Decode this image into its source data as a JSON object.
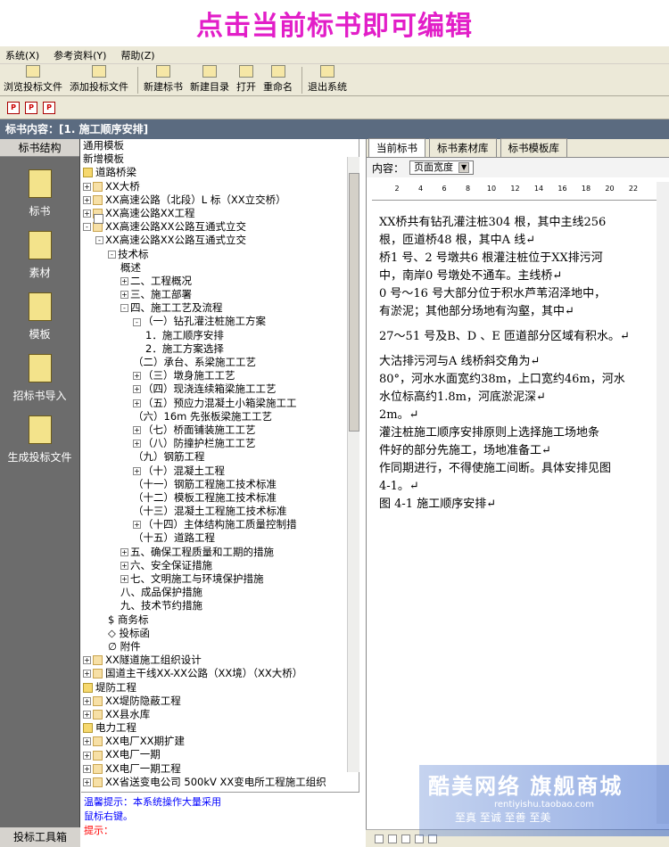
{
  "banner": "点击当前标书即可编辑",
  "menu": [
    "系统(X)",
    "参考资料(Y)",
    "帮助(Z)"
  ],
  "toolbar": [
    "浏览投标文件",
    "添加投标文件",
    "新建标书",
    "新建目录",
    "打开",
    "重命名",
    "退出系统"
  ],
  "title": "标书内容：[1. 施工顺序安排]",
  "left": {
    "header": "标书结构",
    "buttons": [
      "标书",
      "素材",
      "模板",
      "招标书导入",
      "生成投标文件"
    ],
    "footer": "投标工具箱"
  },
  "tree": [
    {
      "indent": 0,
      "box": "",
      "icon": "",
      "label": "通用模板"
    },
    {
      "indent": 0,
      "box": "",
      "icon": "",
      "label": "新增模板"
    },
    {
      "indent": 0,
      "box": "",
      "icon": "folder",
      "label": "道路桥梁"
    },
    {
      "indent": 0,
      "box": "+",
      "icon": "tmpl",
      "label": "XX大桥"
    },
    {
      "indent": 0,
      "box": "+",
      "icon": "tmpl",
      "label": "XX高速公路（北段）L 标（XX立交桥）"
    },
    {
      "indent": 0,
      "box": "+",
      "icon": "tmpl",
      "label": "XX高速公路XX工程"
    },
    {
      "indent": 0,
      "box": "-",
      "icon": "tmpl",
      "label": "XX高速公路XX公路互通式立交"
    },
    {
      "indent": 1,
      "box": "-",
      "icon": "doc",
      "label": "XX高速公路XX公路互通式立交"
    },
    {
      "indent": 2,
      "box": "-",
      "icon": "doc",
      "label": "技术标"
    },
    {
      "indent": 3,
      "box": "",
      "icon": "doc",
      "label": "概述"
    },
    {
      "indent": 3,
      "box": "+",
      "icon": "doc",
      "label": "二、工程概况"
    },
    {
      "indent": 3,
      "box": "+",
      "icon": "doc",
      "label": "三、施工部署"
    },
    {
      "indent": 3,
      "box": "-",
      "icon": "doc",
      "label": "四、施工工艺及流程"
    },
    {
      "indent": 4,
      "box": "-",
      "icon": "doc",
      "label": "（一）钻孔灌注桩施工方案"
    },
    {
      "indent": 5,
      "box": "",
      "icon": "doc",
      "label": "1．施工顺序安排"
    },
    {
      "indent": 5,
      "box": "",
      "icon": "doc",
      "label": "2．施工方案选择"
    },
    {
      "indent": 4,
      "box": "",
      "icon": "doc",
      "label": "（二）承台、系梁施工工艺"
    },
    {
      "indent": 4,
      "box": "+",
      "icon": "doc",
      "label": "（三）墩身施工工艺"
    },
    {
      "indent": 4,
      "box": "+",
      "icon": "doc",
      "label": "（四）现浇连续箱梁施工工艺"
    },
    {
      "indent": 4,
      "box": "+",
      "icon": "doc",
      "label": "（五）预应力混凝土小箱梁施工工"
    },
    {
      "indent": 4,
      "box": "",
      "icon": "doc",
      "label": "（六）16m 先张板梁施工工艺"
    },
    {
      "indent": 4,
      "box": "+",
      "icon": "doc",
      "label": "（七）桥面铺装施工工艺"
    },
    {
      "indent": 4,
      "box": "+",
      "icon": "doc",
      "label": "（八）防撞护栏施工工艺"
    },
    {
      "indent": 4,
      "box": "",
      "icon": "doc",
      "label": "（九）钢筋工程"
    },
    {
      "indent": 4,
      "box": "+",
      "icon": "doc",
      "label": "（十）混凝土工程"
    },
    {
      "indent": 4,
      "box": "",
      "icon": "doc",
      "label": "（十一）钢筋工程施工技术标准"
    },
    {
      "indent": 4,
      "box": "",
      "icon": "doc",
      "label": "（十二）模板工程施工技术标准"
    },
    {
      "indent": 4,
      "box": "",
      "icon": "doc",
      "label": "（十三）混凝土工程施工技术标准"
    },
    {
      "indent": 4,
      "box": "+",
      "icon": "doc",
      "label": "（十四）主体结构施工质量控制措"
    },
    {
      "indent": 4,
      "box": "",
      "icon": "doc",
      "label": "（十五）道路工程"
    },
    {
      "indent": 3,
      "box": "+",
      "icon": "doc",
      "label": "五、确保工程质量和工期的措施"
    },
    {
      "indent": 3,
      "box": "+",
      "icon": "doc",
      "label": "六、安全保证措施"
    },
    {
      "indent": 3,
      "box": "+",
      "icon": "doc",
      "label": "七、文明施工与环境保护措施"
    },
    {
      "indent": 3,
      "box": "",
      "icon": "doc",
      "label": "八、成品保护措施"
    },
    {
      "indent": 3,
      "box": "",
      "icon": "doc",
      "label": "九、技术节约措施"
    },
    {
      "indent": 2,
      "box": "",
      "icon": "",
      "label": "$ 商务标"
    },
    {
      "indent": 2,
      "box": "",
      "icon": "",
      "label": "◇ 投标函"
    },
    {
      "indent": 2,
      "box": "",
      "icon": "",
      "label": "∅ 附件"
    },
    {
      "indent": 0,
      "box": "+",
      "icon": "tmpl",
      "label": "XX隧道施工组织设计"
    },
    {
      "indent": 0,
      "box": "+",
      "icon": "tmpl",
      "label": "国道主干线XX-XX公路（XX境）（XX大桥）"
    },
    {
      "indent": 0,
      "box": "",
      "icon": "folder",
      "label": "堤防工程"
    },
    {
      "indent": 0,
      "box": "+",
      "icon": "tmpl",
      "label": "XX堤防隐蔽工程"
    },
    {
      "indent": 0,
      "box": "+",
      "icon": "tmpl",
      "label": "XX县水库"
    },
    {
      "indent": 0,
      "box": "",
      "icon": "folder",
      "label": "电力工程"
    },
    {
      "indent": 0,
      "box": "+",
      "icon": "tmpl",
      "label": "XX电厂XX期扩建"
    },
    {
      "indent": 0,
      "box": "+",
      "icon": "tmpl",
      "label": "XX电厂一期"
    },
    {
      "indent": 0,
      "box": "+",
      "icon": "tmpl",
      "label": "XX电厂一期工程"
    },
    {
      "indent": 0,
      "box": "+",
      "icon": "tmpl",
      "label": "XX省送变电公司 500kV XX变电所工程施工组织"
    }
  ],
  "status": {
    "a": "温馨提示：本系统操作大量采用",
    "a2": "鼠标右键。",
    "b": "提示："
  },
  "right": {
    "tabs": [
      "当前标书",
      "标书素材库",
      "标书模板库"
    ],
    "zoom_label": "内容：",
    "zoom_value": "页面宽度",
    "ruler": [
      "2",
      "4",
      "6",
      "8",
      "10",
      "12",
      "14",
      "16",
      "18",
      "20",
      "22"
    ],
    "doc": [
      "XX桥共有钻孔灌注桩304 根，其中主线256",
      "根，匝道桥48 根，其中A 线↵",
      "桥1 号、2 号墩共6 根灌注桩位于XX排污河",
      "中，南岸0 号墩处不通车。主线桥↵",
      "0 号～16 号大部分位于积水芦苇沼泽地中，",
      "有淤泥；其他部分场地有沟壑，其中↵",
      "",
      "27～51 号及B、D 、E 匝道部分区域有积水。↵",
      "",
      "大沽排污河与A 线桥斜交角为↵",
      "80°，河水水面宽约38m，上口宽约46m，河水",
      "水位标高约1.8m，河底淤泥深↵",
      "2m。↵",
      "灌注桩施工顺序安排原则上选择施工场地条",
      "件好的部分先施工，场地准备工↵",
      "作同期进行，不得使施工间断。具体安排见图",
      "4-1。↵",
      "图 4-1 施工顺序安排↵"
    ]
  },
  "watermark": {
    "t1": "酷美网络 旗舰商城",
    "t2": "rentiyishu.taobao.com",
    "t3": "至真 至诚  至善 至美"
  }
}
